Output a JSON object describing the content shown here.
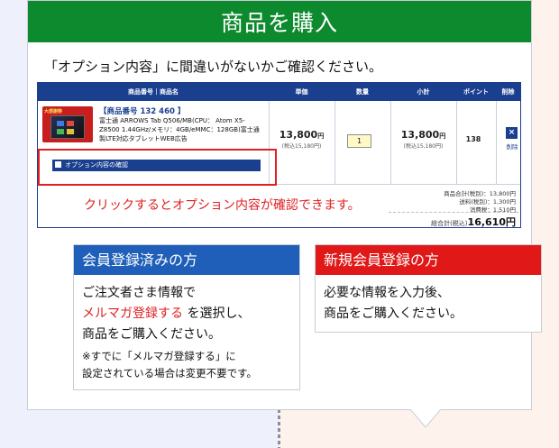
{
  "header": {
    "title": "商品を購入"
  },
  "intro": {
    "text": "「オプション内容」に間違いがないかご確認ください。"
  },
  "cart": {
    "columns": [
      "商品番号｜商品名",
      "単価",
      "数量",
      "小計",
      "ポイント",
      "削除"
    ],
    "item": {
      "badge": "大感謝祭",
      "code": "【商品番号 132 460 】",
      "name": "富士通 ARROWS Tab Q506/MB(CPU： Atom X5-Z8500 1.44GHz/メモリ：4GB/eMMC：128GB)富士通製LTE対応タブレットWEB広告",
      "unit_price": "13,800",
      "unit_price_yen": "円",
      "unit_price_tax": "(税込15,180円)",
      "qty": "1",
      "subtotal": "13,800",
      "subtotal_yen": "円",
      "subtotal_tax": "(税込15,180円)",
      "points": "138",
      "delete_icon": "×",
      "delete_label": "削除"
    },
    "option_bar": "オプション内容の確認",
    "totals": {
      "goods": "商品合計(税別)：13,800円",
      "shipping": "送料(税別)：1,300円",
      "tax": "消費税：1,510円",
      "grand_label": "総合計(税込)",
      "grand_value": "16,610",
      "grand_yen": "円"
    }
  },
  "click_note": "クリックするとオプション内容が確認できます。",
  "member_panel": {
    "title": "会員登録済みの方",
    "line1": "ご注文者さま情報で",
    "line2_red": "メルマガ登録する",
    "line2_rest": " を選択し、",
    "line3": "商品をご購入ください。",
    "note1": "※すでに「メルマガ登録する」に",
    "note2": "設定されている場合は変更不要です。"
  },
  "new_panel": {
    "title": "新規会員登録の方",
    "line1": "必要な情報を入力後、",
    "line2": "商品をご購入ください。"
  },
  "colors": {
    "header_green": "#0d8a2e",
    "cart_navy": "#1a3f8f",
    "member_blue": "#1f5fb9",
    "new_red": "#e01818",
    "note_red": "#e02020"
  }
}
